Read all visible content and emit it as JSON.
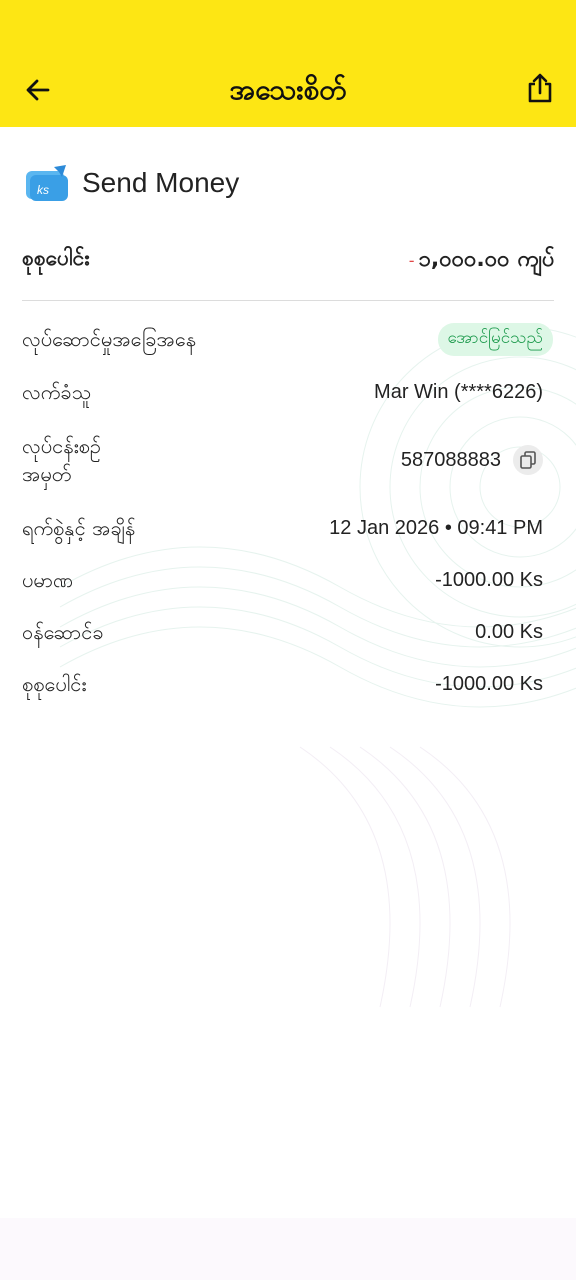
{
  "header": {
    "title": "အသေးစိတ်"
  },
  "service": {
    "name": "Send Money",
    "icon_text": "ks"
  },
  "total": {
    "label": "စုစုပေါင်း",
    "sign": "-",
    "amount": "၁,၀၀၀.၀၀ ကျပ်"
  },
  "details": {
    "status_label": "လုပ်ဆောင်မှုအခြေအနေ",
    "status_value": "အောင်မြင်သည်",
    "receiver_label": "လက်ခံသူ",
    "receiver_value": "Mar Win (****6226)",
    "txn_label_line1": "လုပ်ငန်းစဉ်",
    "txn_label_line2": "အမှတ်",
    "txn_value": "587088883",
    "datetime_label": "ရက်စွဲနှင့် အချိန်",
    "datetime_value": "12 Jan 2026 • 09:41 PM",
    "amount_label": "ပမာဏ",
    "amount_value": "-1000.00 Ks",
    "fee_label": "ဝန်ဆောင်ခ",
    "fee_value": "0.00 Ks",
    "sum_label": "စုစုပေါင်း",
    "sum_value": "-1000.00 Ks"
  },
  "colors": {
    "header_bg": "#fde614",
    "status_green": "#1c9a4c",
    "status_bg": "#ddf7e6",
    "negative_red": "#e04848"
  }
}
